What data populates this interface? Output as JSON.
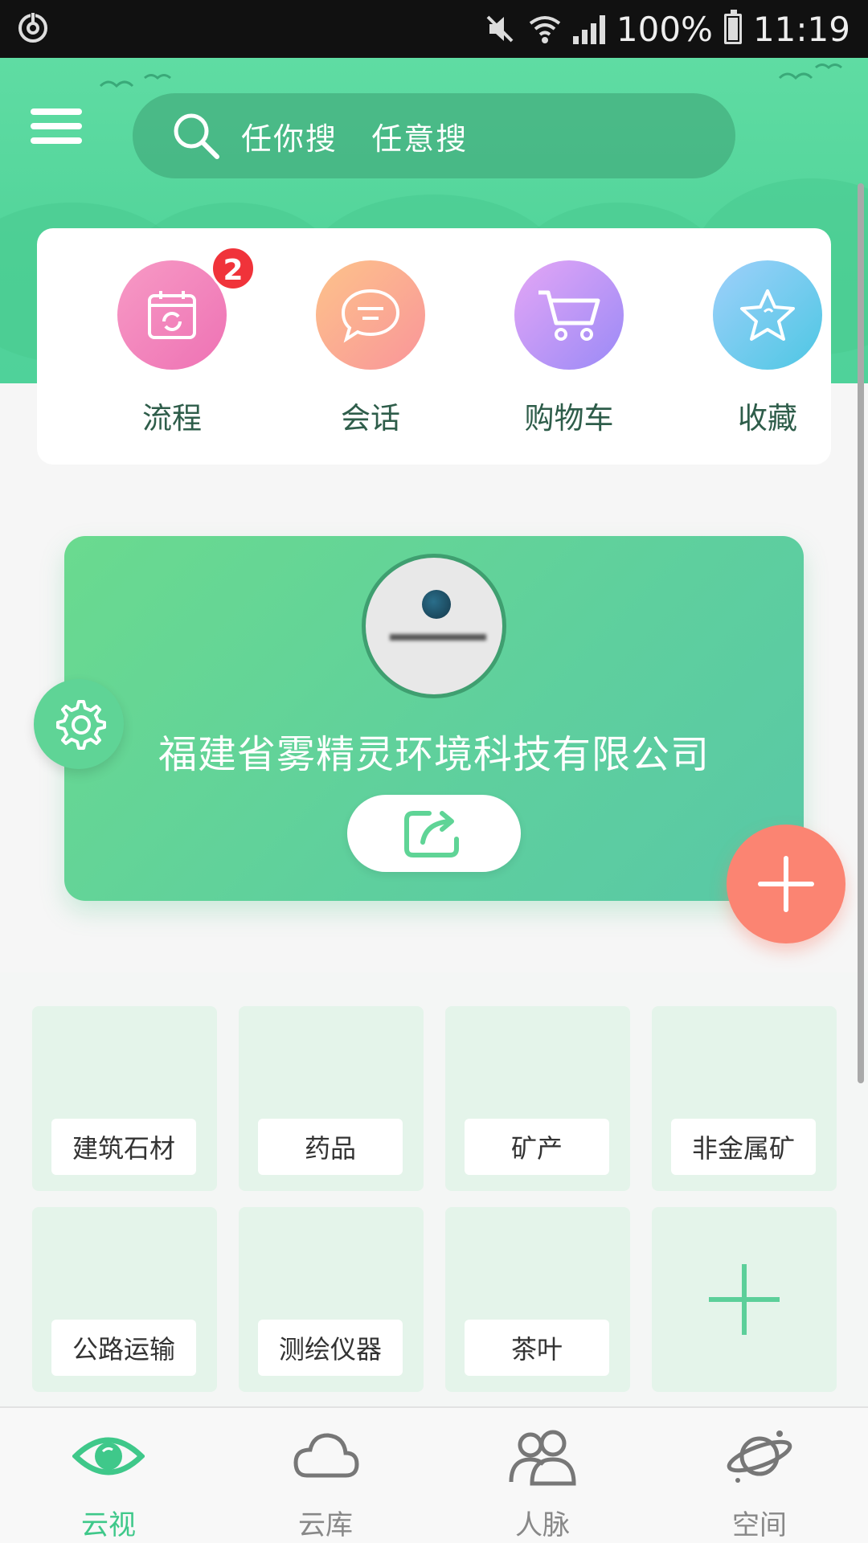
{
  "status_bar": {
    "battery": "100%",
    "time": "11:19"
  },
  "header": {
    "search_placeholder": "任你搜   任意搜"
  },
  "quick_actions": [
    {
      "label": "流程",
      "badge": "2",
      "icon": "calendar-icon"
    },
    {
      "label": "会话",
      "icon": "chat-icon"
    },
    {
      "label": "购物车",
      "icon": "cart-icon"
    },
    {
      "label": "收藏",
      "icon": "star-icon"
    }
  ],
  "company": {
    "name": "福建省雾精灵环境科技有限公司"
  },
  "categories": [
    {
      "label": "建筑石材"
    },
    {
      "label": "药品"
    },
    {
      "label": "矿产"
    },
    {
      "label": "非金属矿"
    },
    {
      "label": "公路运输"
    },
    {
      "label": "测绘仪器"
    },
    {
      "label": "茶叶"
    }
  ],
  "bottom_nav": [
    {
      "label": "云视",
      "icon": "eye-icon",
      "active": true
    },
    {
      "label": "云库",
      "icon": "cloud-icon"
    },
    {
      "label": "人脉",
      "icon": "people-icon"
    },
    {
      "label": "空间",
      "icon": "planet-icon"
    }
  ],
  "colors": {
    "brand_green": "#52d49a",
    "accent_coral": "#fb8472",
    "badge_red": "#f0333a"
  }
}
